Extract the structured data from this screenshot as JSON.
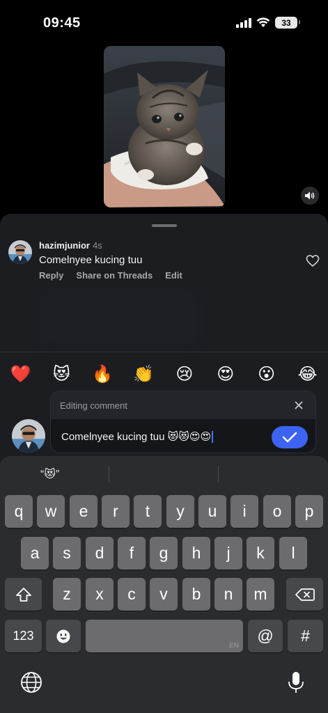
{
  "status_bar": {
    "time": "09:45",
    "battery": "33"
  },
  "post": {
    "media_alt": "kitten-photo",
    "sound_icon": "speaker-icon"
  },
  "comment": {
    "username": "hazimjunior",
    "time_ago": "4s",
    "text": "Comelnyee kucing tuu",
    "actions": [
      "Reply",
      "Share on Threads",
      "Edit"
    ],
    "like_icon": "heart-outline-icon"
  },
  "quick_reactions": [
    "❤️",
    "😻",
    "🔥",
    "👏",
    "😢",
    "😍",
    "😮",
    "😂"
  ],
  "editor": {
    "header_label": "Editing comment",
    "input_value": "Comelnyee kucing tuu 😻😻😍😍",
    "send_icon": "checkmark-icon",
    "close_icon": "close-icon"
  },
  "keyboard": {
    "suggestion": "“😻”",
    "row1": [
      "q",
      "w",
      "e",
      "r",
      "t",
      "y",
      "u",
      "i",
      "o",
      "p"
    ],
    "row2": [
      "a",
      "s",
      "d",
      "f",
      "g",
      "h",
      "j",
      "k",
      "l"
    ],
    "row3": [
      "z",
      "x",
      "c",
      "v",
      "b",
      "n",
      "m"
    ],
    "numbers_key": "123",
    "at_key": "@",
    "hash_key": "#",
    "space_lang": "EN",
    "accent_color": "#3d63f2"
  }
}
